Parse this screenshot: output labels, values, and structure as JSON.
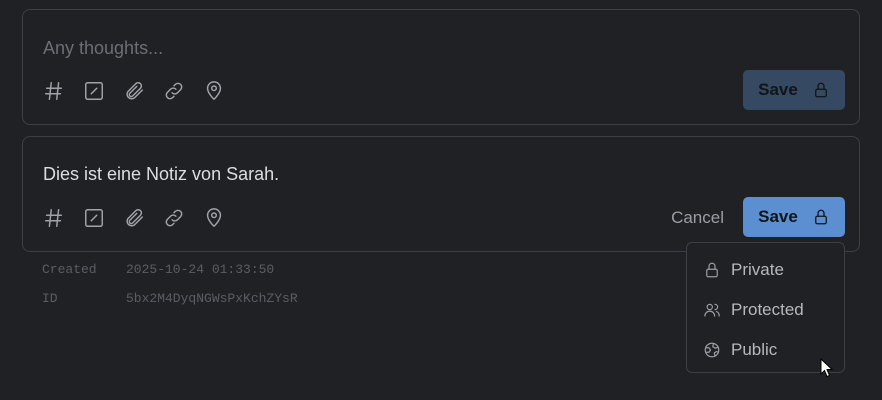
{
  "new_note": {
    "placeholder": "Any thoughts...",
    "save_label": "Save"
  },
  "edit_note": {
    "content": "Dies ist eine Notiz von Sarah.",
    "cancel_label": "Cancel",
    "save_label": "Save"
  },
  "toolbar": {
    "icons": [
      "hash-icon",
      "checkbox-icon",
      "paperclip-icon",
      "link-icon",
      "location-icon"
    ]
  },
  "meta": {
    "created_label": "Created",
    "created_value": "2025-10-24 01:33:50",
    "id_label": "ID",
    "id_value": "5bx2M4DyqNGWsPxKchZYsR"
  },
  "visibility_menu": {
    "items": [
      {
        "label": "Private",
        "icon": "lock-icon"
      },
      {
        "label": "Protected",
        "icon": "users-icon"
      },
      {
        "label": "Public",
        "icon": "globe-icon"
      }
    ]
  },
  "colors": {
    "background": "#202124",
    "save_disabled": "#354a62",
    "save_active": "#5b8fd1"
  }
}
